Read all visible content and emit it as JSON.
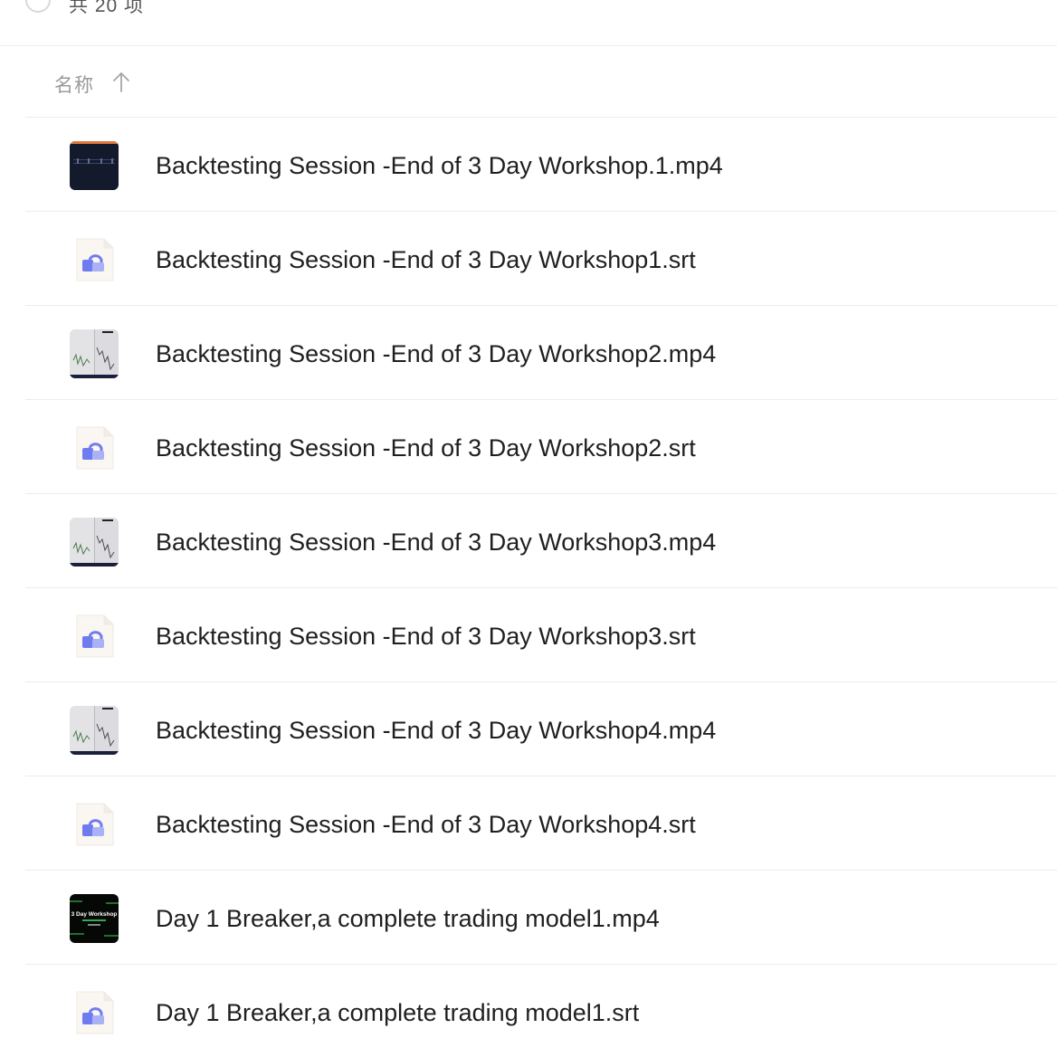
{
  "toolbar": {
    "count_text": "共 20 项"
  },
  "list_header": {
    "name_label": "名称",
    "sort_icon": "arrow-up-icon"
  },
  "files": [
    {
      "name": "Backtesting Session -End of 3 Day Workshop.1.mp4",
      "type": "video",
      "thumb": "dark"
    },
    {
      "name": "Backtesting Session -End of 3 Day Workshop1.srt",
      "type": "subtitle"
    },
    {
      "name": "Backtesting Session -End of 3 Day Workshop2.mp4",
      "type": "video",
      "thumb": "chart-light"
    },
    {
      "name": "Backtesting Session -End of 3 Day Workshop2.srt",
      "type": "subtitle"
    },
    {
      "name": "Backtesting Session -End of 3 Day Workshop3.mp4",
      "type": "video",
      "thumb": "chart-light"
    },
    {
      "name": "Backtesting Session -End of 3 Day Workshop3.srt",
      "type": "subtitle"
    },
    {
      "name": "Backtesting Session -End of 3 Day Workshop4.mp4",
      "type": "video",
      "thumb": "chart-light"
    },
    {
      "name": "Backtesting Session -End of 3 Day Workshop4.srt",
      "type": "subtitle"
    },
    {
      "name": "Day 1 Breaker,a complete trading model1.mp4",
      "type": "video",
      "thumb": "workshop-title",
      "thumb_text": "3 Day Workshop"
    },
    {
      "name": "Day 1 Breaker,a complete trading model1.srt",
      "type": "subtitle"
    }
  ],
  "colors": {
    "subtitle_icon_bg": "#faf6f2",
    "subtitle_icon_accent": "#6f7cf0",
    "dark_thumb": "#131a2c",
    "workshop_thumb": "#050805",
    "workshop_green": "#3fd35f"
  }
}
